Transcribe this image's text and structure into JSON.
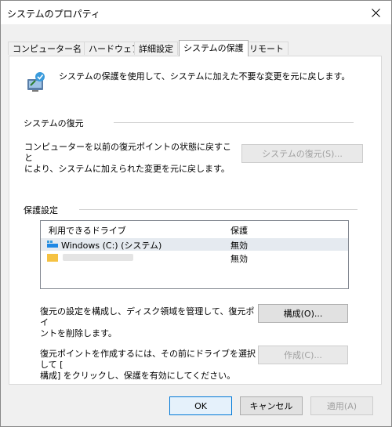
{
  "window": {
    "title": "システムのプロパティ",
    "close_label": "×"
  },
  "tabs": [
    {
      "label": "コンピューター名",
      "active": false
    },
    {
      "label": "ハードウェア",
      "active": false
    },
    {
      "label": "詳細設定",
      "active": false
    },
    {
      "label": "システムの保護",
      "active": true
    },
    {
      "label": "リモート",
      "active": false
    }
  ],
  "intro": {
    "icon": "system-protection-shield-icon",
    "text": "システムの保護を使用して、システムに加えた不要な変更を元に戻します。"
  },
  "restore_group": {
    "label": "システムの復元",
    "description": "コンピューターを以前の復元ポイントの状態に戻すことにより、システムに加えられた変更を元に戻します。",
    "desc_line1": "コンピューターを以前の復元ポイントの状態に戻すこと",
    "desc_line2": "により、システムに加えられた変更を元に戻します。",
    "button_label": "システムの復元(S)...",
    "button_enabled": false
  },
  "protection_group": {
    "label": "保護設定",
    "columns": [
      "利用できるドライブ",
      "保護"
    ],
    "drives": [
      {
        "name": "Windows (C:) (システム)",
        "protection": "無効",
        "icon": "system-drive-icon",
        "selected": true
      },
      {
        "name": "",
        "protection": "無効",
        "icon": "folder-drive-icon",
        "selected": false
      }
    ],
    "configure_text_line1": "復元の設定を構成し、ディスク領域を管理して、復元ポイ",
    "configure_text_line2": "ントを削除します。",
    "configure_button": "構成(O)...",
    "create_text_line1": "復元ポイントを作成するには、その前にドライブを選択して [",
    "create_text_line2": "構成] をクリックし、保護を有効にしてください。",
    "create_button": "作成(C)...",
    "create_enabled": false
  },
  "footer": {
    "ok": "OK",
    "cancel": "キャンセル",
    "apply": "適用(A)"
  },
  "colors": {
    "accent": "#0078d7",
    "drive_icon": "#1e88e5",
    "folder_icon": "#f5c242"
  }
}
